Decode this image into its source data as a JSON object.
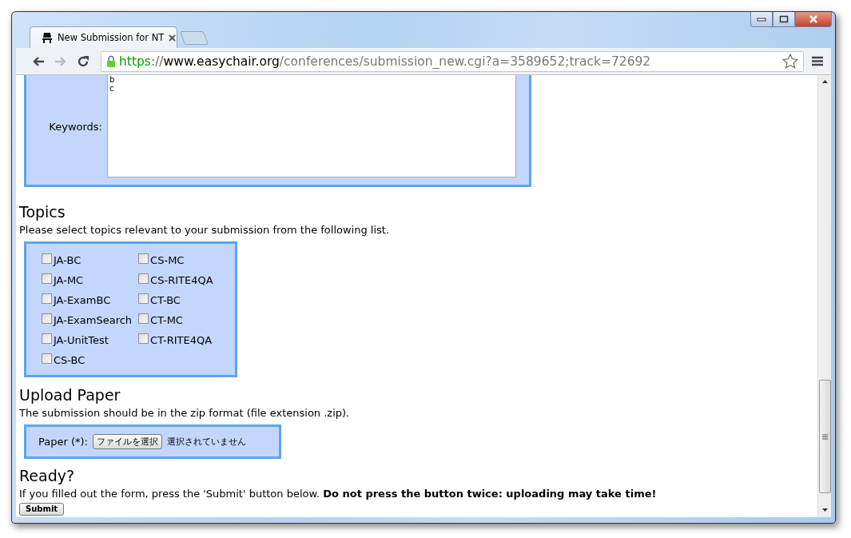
{
  "window": {
    "tab": {
      "title": "New Submission for NT",
      "selected": true
    },
    "url": [
      {
        "kind": "scheme",
        "text": "https"
      },
      {
        "kind": "sep",
        "text": "://"
      },
      {
        "kind": "host",
        "text": "www.easychair.org"
      },
      {
        "kind": "path",
        "text": "/conferences/submission_new.cgi?a=3589652;track=72692"
      }
    ]
  },
  "keywords": {
    "label": "Keywords:",
    "value": "b\nc"
  },
  "topics": {
    "heading": "Topics",
    "description": "Please select topics relevant to your submission from the following list.",
    "columns": [
      [
        {
          "label": "JA-BC",
          "checked": false
        },
        {
          "label": "JA-MC",
          "checked": false
        },
        {
          "label": "JA-ExamBC",
          "checked": false
        },
        {
          "label": "JA-ExamSearch",
          "checked": false
        },
        {
          "label": "JA-UnitTest",
          "checked": false
        },
        {
          "label": "CS-BC",
          "checked": false
        }
      ],
      [
        {
          "label": "CS-MC",
          "checked": false
        },
        {
          "label": "CS-RITE4QA",
          "checked": false
        },
        {
          "label": "CT-BC",
          "checked": false
        },
        {
          "label": "CT-MC",
          "checked": false
        },
        {
          "label": "CT-RITE4QA",
          "checked": false
        }
      ]
    ]
  },
  "upload": {
    "heading": "Upload Paper",
    "description": "The submission should be in the zip format (file extension .zip).",
    "label": "Paper (*):",
    "button": "ファイルを選択",
    "status": "選択されていません"
  },
  "ready": {
    "heading": "Ready?",
    "text": "If you filled out the form, press the 'Submit' button below. **Do not press the button twice: uploading may take time!**",
    "button": "Submit"
  }
}
